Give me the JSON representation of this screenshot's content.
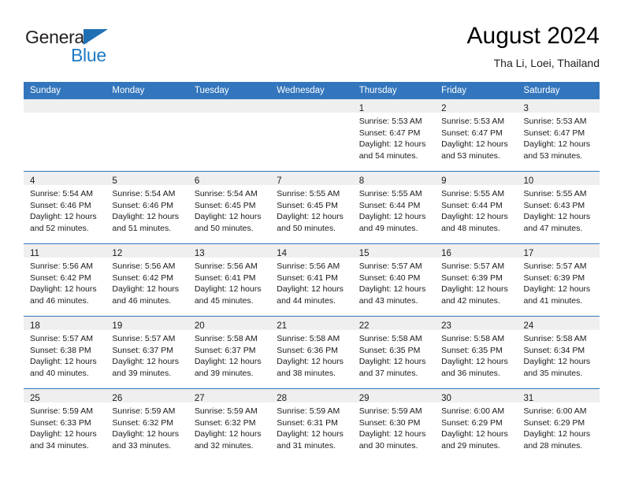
{
  "brand": {
    "name_top": "General",
    "name_bottom": "Blue",
    "accent_color": "#1f7ac4",
    "triangle_color": "#1f6fb5"
  },
  "header": {
    "title": "August 2024",
    "subtitle": "Tha Li, Loei, Thailand"
  },
  "theme": {
    "header_row_bg": "#3376bd",
    "header_row_text": "#ffffff",
    "daynum_band_bg": "#efefef",
    "row_divider": "#3376bd",
    "page_bg": "#ffffff"
  },
  "weekdays": [
    "Sunday",
    "Monday",
    "Tuesday",
    "Wednesday",
    "Thursday",
    "Friday",
    "Saturday"
  ],
  "weeks": [
    [
      {
        "day": "",
        "lines": []
      },
      {
        "day": "",
        "lines": []
      },
      {
        "day": "",
        "lines": []
      },
      {
        "day": "",
        "lines": []
      },
      {
        "day": "1",
        "lines": [
          "Sunrise: 5:53 AM",
          "Sunset: 6:47 PM",
          "Daylight: 12 hours",
          "and 54 minutes."
        ]
      },
      {
        "day": "2",
        "lines": [
          "Sunrise: 5:53 AM",
          "Sunset: 6:47 PM",
          "Daylight: 12 hours",
          "and 53 minutes."
        ]
      },
      {
        "day": "3",
        "lines": [
          "Sunrise: 5:53 AM",
          "Sunset: 6:47 PM",
          "Daylight: 12 hours",
          "and 53 minutes."
        ]
      }
    ],
    [
      {
        "day": "4",
        "lines": [
          "Sunrise: 5:54 AM",
          "Sunset: 6:46 PM",
          "Daylight: 12 hours",
          "and 52 minutes."
        ]
      },
      {
        "day": "5",
        "lines": [
          "Sunrise: 5:54 AM",
          "Sunset: 6:46 PM",
          "Daylight: 12 hours",
          "and 51 minutes."
        ]
      },
      {
        "day": "6",
        "lines": [
          "Sunrise: 5:54 AM",
          "Sunset: 6:45 PM",
          "Daylight: 12 hours",
          "and 50 minutes."
        ]
      },
      {
        "day": "7",
        "lines": [
          "Sunrise: 5:55 AM",
          "Sunset: 6:45 PM",
          "Daylight: 12 hours",
          "and 50 minutes."
        ]
      },
      {
        "day": "8",
        "lines": [
          "Sunrise: 5:55 AM",
          "Sunset: 6:44 PM",
          "Daylight: 12 hours",
          "and 49 minutes."
        ]
      },
      {
        "day": "9",
        "lines": [
          "Sunrise: 5:55 AM",
          "Sunset: 6:44 PM",
          "Daylight: 12 hours",
          "and 48 minutes."
        ]
      },
      {
        "day": "10",
        "lines": [
          "Sunrise: 5:55 AM",
          "Sunset: 6:43 PM",
          "Daylight: 12 hours",
          "and 47 minutes."
        ]
      }
    ],
    [
      {
        "day": "11",
        "lines": [
          "Sunrise: 5:56 AM",
          "Sunset: 6:42 PM",
          "Daylight: 12 hours",
          "and 46 minutes."
        ]
      },
      {
        "day": "12",
        "lines": [
          "Sunrise: 5:56 AM",
          "Sunset: 6:42 PM",
          "Daylight: 12 hours",
          "and 46 minutes."
        ]
      },
      {
        "day": "13",
        "lines": [
          "Sunrise: 5:56 AM",
          "Sunset: 6:41 PM",
          "Daylight: 12 hours",
          "and 45 minutes."
        ]
      },
      {
        "day": "14",
        "lines": [
          "Sunrise: 5:56 AM",
          "Sunset: 6:41 PM",
          "Daylight: 12 hours",
          "and 44 minutes."
        ]
      },
      {
        "day": "15",
        "lines": [
          "Sunrise: 5:57 AM",
          "Sunset: 6:40 PM",
          "Daylight: 12 hours",
          "and 43 minutes."
        ]
      },
      {
        "day": "16",
        "lines": [
          "Sunrise: 5:57 AM",
          "Sunset: 6:39 PM",
          "Daylight: 12 hours",
          "and 42 minutes."
        ]
      },
      {
        "day": "17",
        "lines": [
          "Sunrise: 5:57 AM",
          "Sunset: 6:39 PM",
          "Daylight: 12 hours",
          "and 41 minutes."
        ]
      }
    ],
    [
      {
        "day": "18",
        "lines": [
          "Sunrise: 5:57 AM",
          "Sunset: 6:38 PM",
          "Daylight: 12 hours",
          "and 40 minutes."
        ]
      },
      {
        "day": "19",
        "lines": [
          "Sunrise: 5:57 AM",
          "Sunset: 6:37 PM",
          "Daylight: 12 hours",
          "and 39 minutes."
        ]
      },
      {
        "day": "20",
        "lines": [
          "Sunrise: 5:58 AM",
          "Sunset: 6:37 PM",
          "Daylight: 12 hours",
          "and 39 minutes."
        ]
      },
      {
        "day": "21",
        "lines": [
          "Sunrise: 5:58 AM",
          "Sunset: 6:36 PM",
          "Daylight: 12 hours",
          "and 38 minutes."
        ]
      },
      {
        "day": "22",
        "lines": [
          "Sunrise: 5:58 AM",
          "Sunset: 6:35 PM",
          "Daylight: 12 hours",
          "and 37 minutes."
        ]
      },
      {
        "day": "23",
        "lines": [
          "Sunrise: 5:58 AM",
          "Sunset: 6:35 PM",
          "Daylight: 12 hours",
          "and 36 minutes."
        ]
      },
      {
        "day": "24",
        "lines": [
          "Sunrise: 5:58 AM",
          "Sunset: 6:34 PM",
          "Daylight: 12 hours",
          "and 35 minutes."
        ]
      }
    ],
    [
      {
        "day": "25",
        "lines": [
          "Sunrise: 5:59 AM",
          "Sunset: 6:33 PM",
          "Daylight: 12 hours",
          "and 34 minutes."
        ]
      },
      {
        "day": "26",
        "lines": [
          "Sunrise: 5:59 AM",
          "Sunset: 6:32 PM",
          "Daylight: 12 hours",
          "and 33 minutes."
        ]
      },
      {
        "day": "27",
        "lines": [
          "Sunrise: 5:59 AM",
          "Sunset: 6:32 PM",
          "Daylight: 12 hours",
          "and 32 minutes."
        ]
      },
      {
        "day": "28",
        "lines": [
          "Sunrise: 5:59 AM",
          "Sunset: 6:31 PM",
          "Daylight: 12 hours",
          "and 31 minutes."
        ]
      },
      {
        "day": "29",
        "lines": [
          "Sunrise: 5:59 AM",
          "Sunset: 6:30 PM",
          "Daylight: 12 hours",
          "and 30 minutes."
        ]
      },
      {
        "day": "30",
        "lines": [
          "Sunrise: 6:00 AM",
          "Sunset: 6:29 PM",
          "Daylight: 12 hours",
          "and 29 minutes."
        ]
      },
      {
        "day": "31",
        "lines": [
          "Sunrise: 6:00 AM",
          "Sunset: 6:29 PM",
          "Daylight: 12 hours",
          "and 28 minutes."
        ]
      }
    ]
  ]
}
